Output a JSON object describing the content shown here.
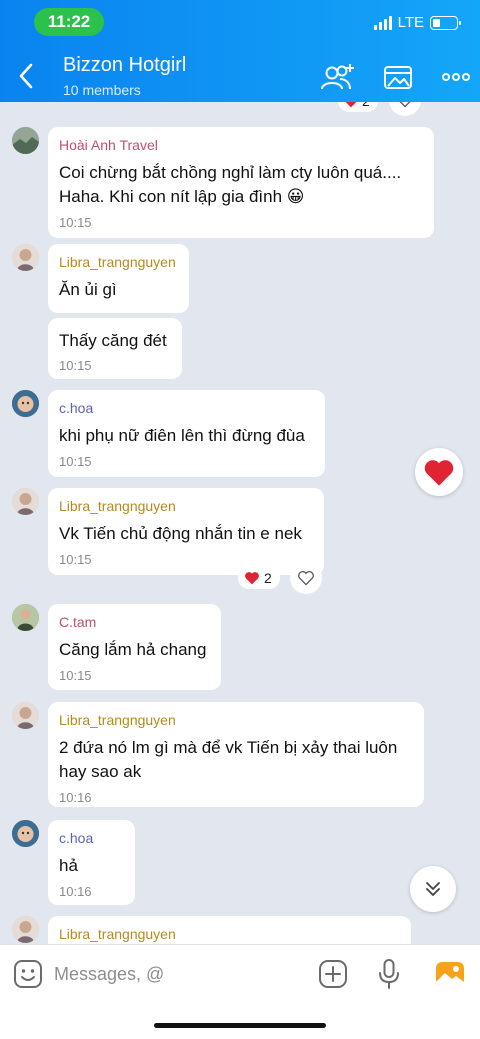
{
  "status_bar": {
    "time": "11:22",
    "network": "LTE",
    "battery_level": 0.3
  },
  "header": {
    "title": "Bizzon Hotgirl",
    "subtitle": "10 members"
  },
  "top_partial": {
    "reaction_count": "2"
  },
  "messages": [
    {
      "sender": "Hoài Anh Travel",
      "sender_color": "#c0506a",
      "text": "Coi chừng bắt chồng nghỉ làm cty luôn quá.... Haha. Khi con nít lập gia đình 😀",
      "time": "10:15"
    },
    {
      "sender": "Libra_trangnguyen",
      "sender_color": "#b58a1f",
      "text": "Ăn ủi gì"
    },
    {
      "text": "Thấy căng đét",
      "time": "10:15"
    },
    {
      "sender": "c.hoa",
      "sender_color": "#5a62b8",
      "text": "khi phụ nữ điên lên thì đừng đùa",
      "time": "10:15"
    },
    {
      "sender": "Libra_trangnguyen",
      "sender_color": "#b58a1f",
      "text": "Vk Tiến chủ động nhắn tin e nek",
      "time": "10:15",
      "reaction_count": "2"
    },
    {
      "sender": "C.tam",
      "sender_color": "#c0506a",
      "text": "Căng lắm hả chang",
      "time": "10:15"
    },
    {
      "sender": "Libra_trangnguyen",
      "sender_color": "#b58a1f",
      "text": "2 đứa nó lm gì mà để vk Tiến bị xảy thai luôn hay sao ak",
      "time": "10:16"
    },
    {
      "sender": "c.hoa",
      "sender_color": "#5a62b8",
      "text": "hả",
      "time": "10:16"
    },
    {
      "sender": "Libra_trangnguyen",
      "sender_color": "#b58a1f"
    }
  ],
  "input": {
    "placeholder": "Messages, @"
  },
  "icons": {
    "back": "chevron-left-icon",
    "add_member": "add-member-icon",
    "gallery": "gallery-icon",
    "more": "more-icon",
    "sticker": "sticker-icon",
    "plus": "plus-icon",
    "mic": "microphone-icon",
    "photo": "photo-icon",
    "heart": "heart-icon",
    "scroll": "chevron-double-down-icon"
  },
  "colors": {
    "header": "#0a83f0",
    "background": "#e2e6ee",
    "status_time_pill": "#2cc04c",
    "heart": "#e02434"
  }
}
